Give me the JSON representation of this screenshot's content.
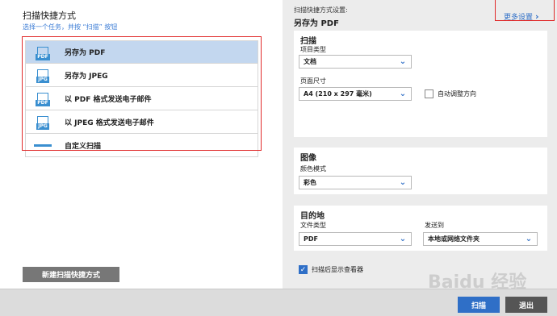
{
  "left": {
    "title": "扫描快捷方式",
    "subtitle": "选择一个任务，并按 “扫描” 按钮",
    "shortcuts": [
      {
        "label": "另存为 PDF",
        "icon": "pdf-icon",
        "tag": "PDF",
        "selected": true
      },
      {
        "label": "另存为 JPEG",
        "icon": "jpg-icon",
        "tag": "JPG"
      },
      {
        "label": "以 PDF 格式发送电子邮件",
        "icon": "pdf-email-icon",
        "tag": "PDF"
      },
      {
        "label": "以 JPEG 格式发送电子邮件",
        "icon": "jpg-email-icon",
        "tag": "JPG"
      },
      {
        "label": "自定义扫描",
        "icon": "custom-scan-icon"
      }
    ],
    "new_button": "新建扫描快捷方式"
  },
  "right": {
    "caption": "扫描快捷方式设置:",
    "name": "另存为 PDF",
    "more": "更多设置",
    "scan_panel": {
      "title": "扫描",
      "item_type_label": "项目类型",
      "item_type_value": "文档",
      "page_size_label": "页面尺寸",
      "page_size_value": "A4 (210 x 297 毫米)",
      "auto_orient_label": "自动调整方向"
    },
    "image_panel": {
      "title": "图像",
      "color_mode_label": "颜色模式",
      "color_mode_value": "彩色"
    },
    "dest_panel": {
      "title": "目的地",
      "file_type_label": "文件类型",
      "file_type_value": "PDF",
      "send_to_label": "发送到",
      "send_to_value": "本地或网络文件夹"
    },
    "show_viewer_label": "扫描后显示查看器"
  },
  "footer": {
    "scan": "扫描",
    "exit": "退出"
  },
  "watermark": "Baidu 经验",
  "colors": {
    "accent": "#2f6fc7",
    "selected": "#c3d7ef",
    "highlight": "#e02a2a"
  }
}
